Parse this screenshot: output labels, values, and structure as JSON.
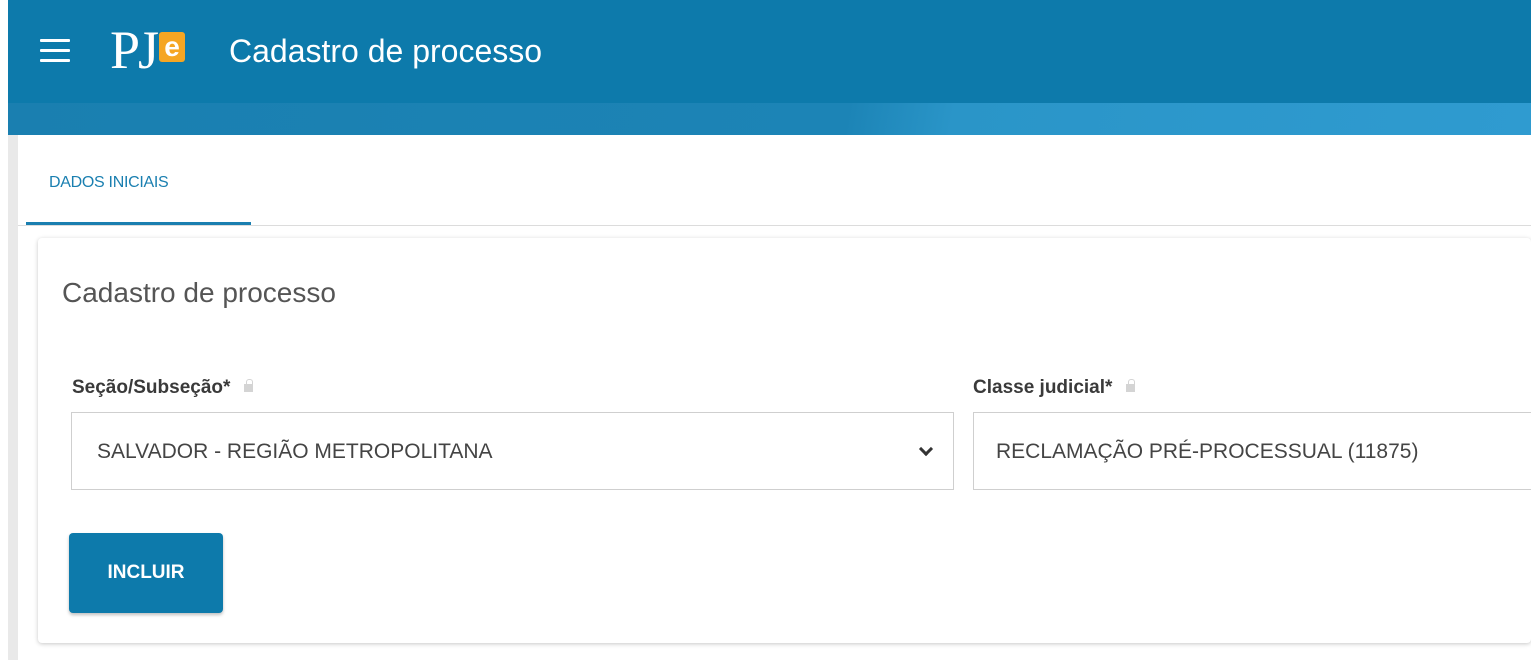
{
  "header": {
    "logo_text": "PJ",
    "logo_accent": "e",
    "title": "Cadastro de processo",
    "brand_color": "#0d7aab",
    "accent_color": "#f5a623"
  },
  "tabs": [
    {
      "label": "DADOS INICIAIS",
      "active": true
    }
  ],
  "form": {
    "title": "Cadastro de processo",
    "secao": {
      "label": "Seção/Subseção*",
      "value": "SALVADOR - REGIÃO METROPOLITANA"
    },
    "classe": {
      "label": "Classe judicial*",
      "value": "RECLAMAÇÃO PRÉ-PROCESSUAL (11875)"
    },
    "submit_label": "INCLUIR"
  },
  "icons": {
    "menu": "hamburger-menu-icon",
    "lock": "lock-icon",
    "chevron": "chevron-down-icon"
  }
}
